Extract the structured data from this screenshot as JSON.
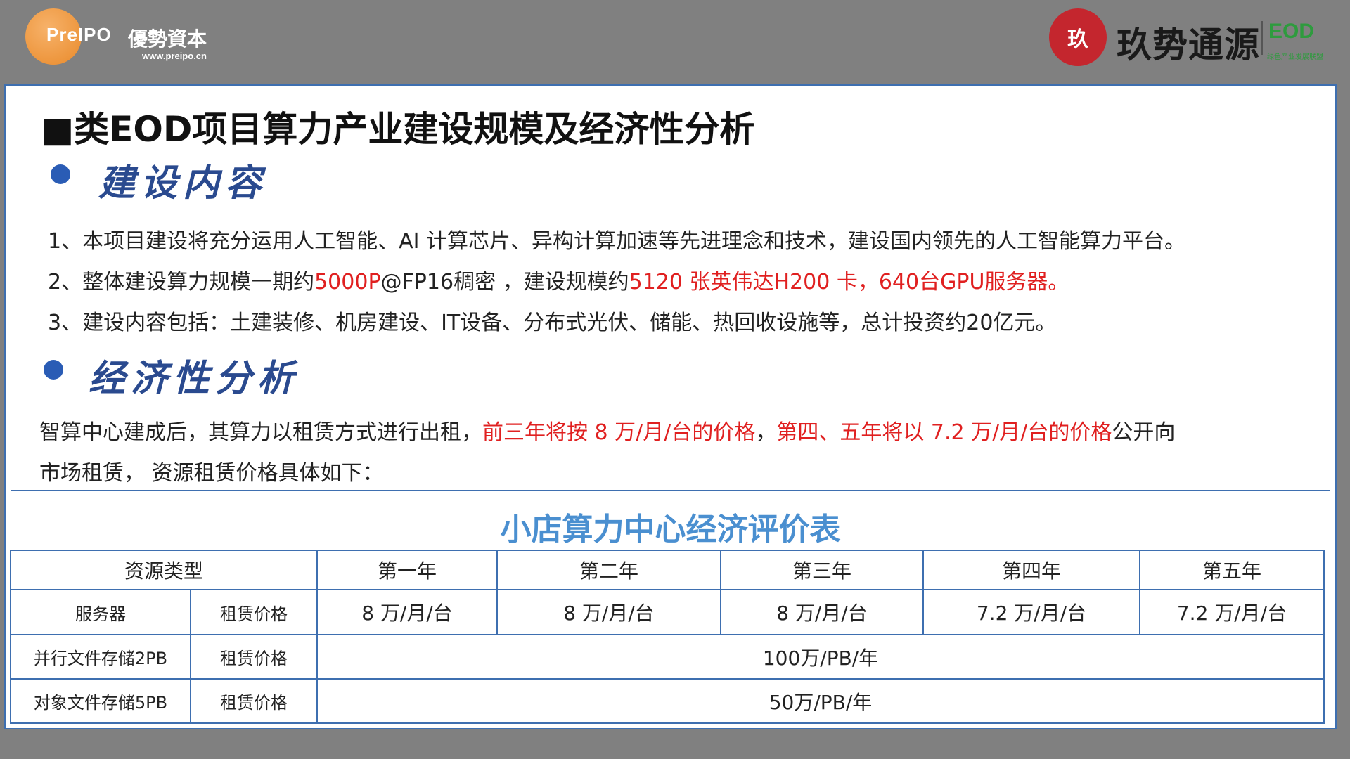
{
  "header": {
    "left_logo": {
      "brand": "PreIPO",
      "name_cn": "優勢資本",
      "url": "www.preipo.cn",
      "color": "#e98a2a"
    },
    "right_logo": {
      "seal_text": "玖",
      "name_cn": "玖势通源",
      "eod": "EOD",
      "eod_sub": "绿色产业发展联盟",
      "seal_color": "#c4262e"
    }
  },
  "title": "■类EOD项目算力产业建设规模及经济性分析",
  "section1": {
    "heading": "建设内容",
    "items": [
      {
        "plain": "1、本项目建设将充分运用人工智能、AI 计算芯片、异构计算加速等先进理念和技术，建设国内领先的人工智能算力平台。"
      },
      {
        "p1": "2、整体建设算力规模一期约",
        "r1": "5000P",
        "p2": "@FP16稠密 ，建设规模约",
        "r2": "5120 张英伟达H200 卡，640台GPU服务器。"
      },
      {
        "plain": "3、建设内容包括：土建装修、机房建设、IT设备、分布式光伏、储能、热回收设施等，总计投资约20亿元。"
      }
    ]
  },
  "section2": {
    "heading": "经济性分析",
    "p1": "智算中心建成后，其算力以租赁方式进行出租，",
    "r1": "前三年将按 8 万/月/台的价格",
    "p2": "，",
    "r2": "第四、五年将以 7.2 万/月/台的价格",
    "p3": "公开向",
    "line2": "市场租赁， 资源租赁价格具体如下："
  },
  "table": {
    "title": "小店算力中心经济评价表",
    "header": [
      "资源类型",
      "第一年",
      "第二年",
      "第三年",
      "第四年",
      "第五年"
    ],
    "server": {
      "type": "服务器",
      "metric": "租赁价格",
      "values": [
        "8 万/月/台",
        "8 万/月/台",
        "8 万/月/台",
        "7.2 万/月/台",
        "7.2 万/月/台"
      ]
    },
    "parallel": {
      "type": "并行文件存储2PB",
      "metric": "租赁价格",
      "value": "100万/PB/年"
    },
    "object": {
      "type": "对象文件存储5PB",
      "metric": "租赁价格",
      "value": "50万/PB/年"
    }
  },
  "colors": {
    "accent_blue": "#3e6fb0",
    "highlight_red": "#e02020",
    "table_title": "#4a8fd0"
  }
}
